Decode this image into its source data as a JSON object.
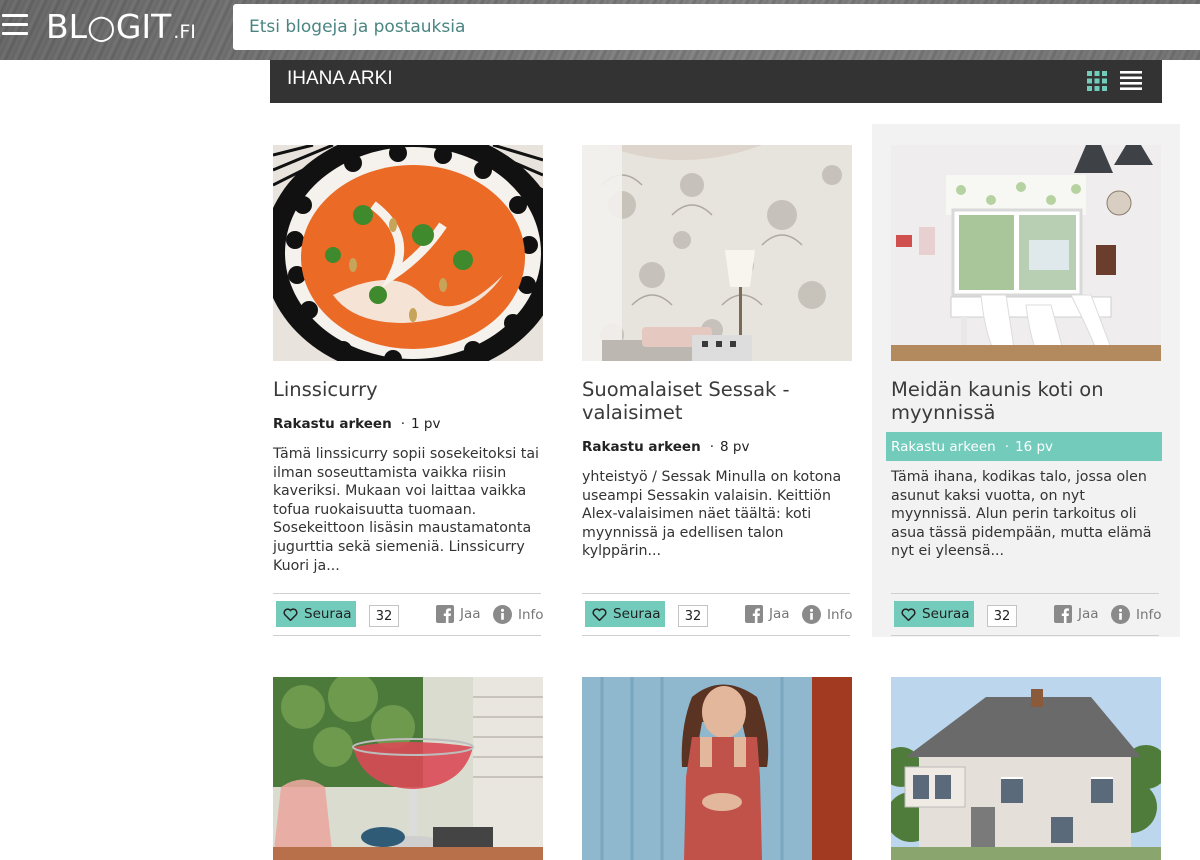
{
  "header": {
    "logo_main": "BL○GIT",
    "logo_suffix": ".FI",
    "search_placeholder": "Etsi blogeja ja postauksia"
  },
  "category": {
    "title": "IHANA ARKI"
  },
  "posts": [
    {
      "title": "Linssicurry",
      "author": "Rakastu arkeen",
      "age": "1 pv",
      "excerpt": "Tämä linssicurry sopii sosekeitoksi tai ilman soseuttamista vaikka riisin kaveriksi. Mukaan voi laittaa vaikka tofua ruokaisuutta tuomaan. Sosekeittoon lisäsin maustamatonta jugurttia sekä siemeniä. Linssicurry Kuori ja...",
      "follow_label": "Seuraa",
      "follow_count": "32",
      "share_label": "Jaa",
      "info_label": "Info"
    },
    {
      "title": "Suomalaiset Sessak - valaisimet",
      "author": "Rakastu arkeen",
      "age": "8 pv",
      "excerpt": "yhteistyö / Sessak Minulla on kotona useampi Sessakin valaisin. Keittiön Alex-valaisimen näet täältä: koti myynnissä ja edellisen talon kylppärin...",
      "follow_label": "Seuraa",
      "follow_count": "32",
      "share_label": "Jaa",
      "info_label": "Info"
    },
    {
      "title": "Meidän kaunis koti on myynnissä",
      "author": "Rakastu arkeen",
      "age": "16 pv",
      "excerpt": "Tämä ihana, kodikas talo, jossa olen asunut kaksi vuotta, on nyt myynnissä. Alun perin tarkoitus oli asua tässä pidempään, mutta elämä nyt ei yleensä...",
      "follow_label": "Seuraa",
      "follow_count": "32",
      "share_label": "Jaa",
      "info_label": "Info"
    }
  ],
  "colors": {
    "accent": "#72cbbb",
    "header_bg": "#333333",
    "search_text": "#4a8582"
  }
}
